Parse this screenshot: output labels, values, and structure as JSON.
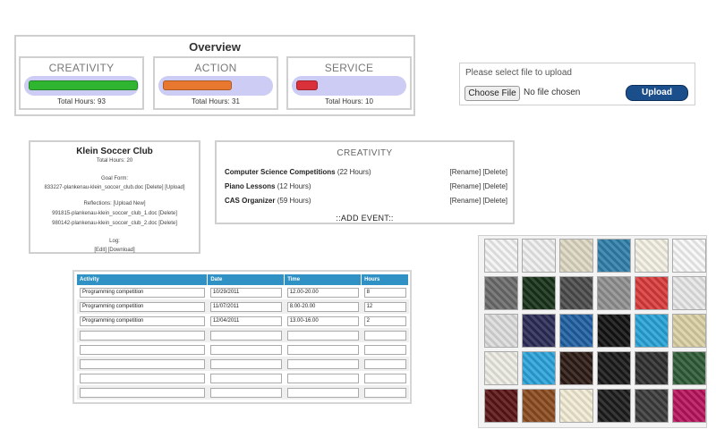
{
  "overview": {
    "title": "Overview",
    "cards": [
      {
        "name": "CREATIVITY",
        "hours": "Total Hours: 93",
        "color": "#2fb52f",
        "fill": 0.97
      },
      {
        "name": "ACTION",
        "hours": "Total Hours: 31",
        "color": "#e8782f",
        "fill": 0.61
      },
      {
        "name": "SERVICE",
        "hours": "Total Hours: 10",
        "color": "#d9303a",
        "fill": 0.19
      }
    ]
  },
  "upload": {
    "prompt": "Please select file to upload",
    "choose_label": "Choose File",
    "no_file": "No file chosen",
    "upload_label": "Upload"
  },
  "club": {
    "name": "Klein Soccer Club",
    "total_hours": "Total Hours: 20",
    "goal_form_label": "Goal Form:",
    "goal_file": "833227-plankenau-klein_soccer_club.doc [Delete] [Upload]",
    "reflections_label": "Reflections: [Upload New]",
    "reflection_1": "991815-plankenau-klein_soccer_club_1.doc [Delete]",
    "reflection_2": "980142-plankenau-klein_soccer_club_2.doc [Delete]",
    "log_label": "Log:",
    "log_actions": "[Edit] [Download]"
  },
  "creativity": {
    "title": "CREATIVITY",
    "events": [
      {
        "name": "Computer Science Competitions",
        "hours": "(22 Hours)",
        "actions": "[Rename] [Delete]"
      },
      {
        "name": "Piano Lessons",
        "hours": "(12 Hours)",
        "actions": "[Rename] [Delete]"
      },
      {
        "name": "CAS Organizer",
        "hours": "(59 Hours)",
        "actions": "[Rename] [Delete]"
      }
    ],
    "add_event": "::ADD EVENT::"
  },
  "table": {
    "headers": [
      "Activity",
      "Date",
      "Time",
      "Hours"
    ],
    "rows": [
      [
        "Programming competition",
        "10/29/2011",
        "12.00-20.00",
        "8"
      ],
      [
        "Programming competition",
        "11/07/2011",
        "8.00-20.00",
        "12"
      ],
      [
        "Programming competition",
        "12/04/2011",
        "13.00-16.00",
        "2"
      ],
      [
        "",
        "",
        "",
        ""
      ],
      [
        "",
        "",
        "",
        ""
      ],
      [
        "",
        "",
        "",
        ""
      ],
      [
        "",
        "",
        "",
        ""
      ],
      [
        "",
        "",
        "",
        ""
      ]
    ]
  },
  "swatches": {
    "patterns": [
      "white-plain",
      "white-floral",
      "beige-damask",
      "blue-diamond",
      "cream-lattice",
      "white-scroll",
      "gray-stars",
      "green-circuit",
      "gray-stone",
      "gray-circles",
      "red-argyle",
      "white-leopard",
      "white-ornament",
      "navy-circles",
      "blue-tile",
      "black-curve",
      "cyan-diamond",
      "beige-floral",
      "cream-grid",
      "sky-blue",
      "dark-fleur",
      "black-argyle",
      "dark-plaid",
      "green-paisley",
      "maroon-floral",
      "bronze-swirl",
      "cream-dots",
      "black-mesh",
      "gray-weave",
      "pink-rays"
    ],
    "colors": [
      "#f2f2f2",
      "#eeeeee",
      "#ddd6c2",
      "#2f7fa8",
      "#f3efe2",
      "#f6f6f6",
      "#6a6a6a",
      "#163017",
      "#4a4a4a",
      "#8e8e8e",
      "#d83a3a",
      "#e6e6e6",
      "#dcdcdc",
      "#2a2a55",
      "#1e5fa0",
      "#111111",
      "#27a2d6",
      "#d9cfa4",
      "#ecebe3",
      "#2aa3da",
      "#2b1a14",
      "#181818",
      "#2e2e2e",
      "#2e5a35",
      "#5a1414",
      "#8a4a1e",
      "#f1ebd3",
      "#1b1b1b",
      "#3a3a3a",
      "#b7125a"
    ]
  }
}
